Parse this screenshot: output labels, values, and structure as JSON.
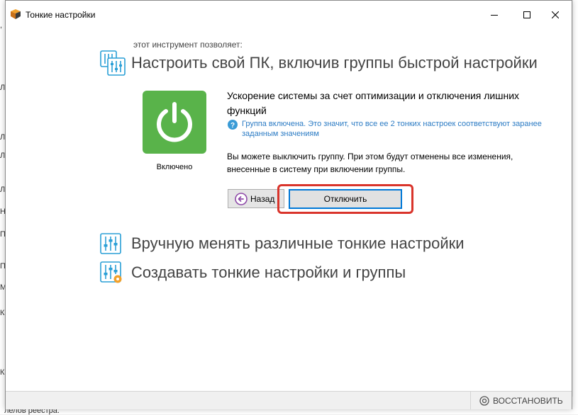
{
  "background": {
    "left_fragments": [
      ",",
      "Л",
      "Л",
      "Л",
      "Л",
      "Н",
      "П",
      "П",
      "М",
      "К",
      "К"
    ],
    "bottom_text": "лелов реестра."
  },
  "window": {
    "title": "Тонкие настройки",
    "controls": [
      "minimize",
      "maximize",
      "close"
    ]
  },
  "intro": "этот инструмент позволяет:",
  "sections": {
    "quick": "Настроить свой ПК, включив группы быстрой настройки",
    "manual": "Вручную менять различные тонкие настройки",
    "create": "Создавать тонкие настройки и группы"
  },
  "group": {
    "status": "Включено",
    "description": "Ускорение системы за счет оптимизации и отключения лишних функций",
    "info": "Группа включена. Это значит, что все ее 2 тонких настроек соответствуют заранее заданным значениям",
    "warning": "Вы можете выключить группу. При этом будут отменены все изменения, внесенные в систему при включении группы."
  },
  "buttons": {
    "back": "Назад",
    "disable": "Отключить"
  },
  "statusbar": {
    "restore": "ВОССТАНОВИТЬ"
  },
  "colors": {
    "power_tile": "#59b34a",
    "accent_blue": "#2b7bc4",
    "highlight_red": "#d9342b",
    "focus_blue": "#0078d7"
  }
}
